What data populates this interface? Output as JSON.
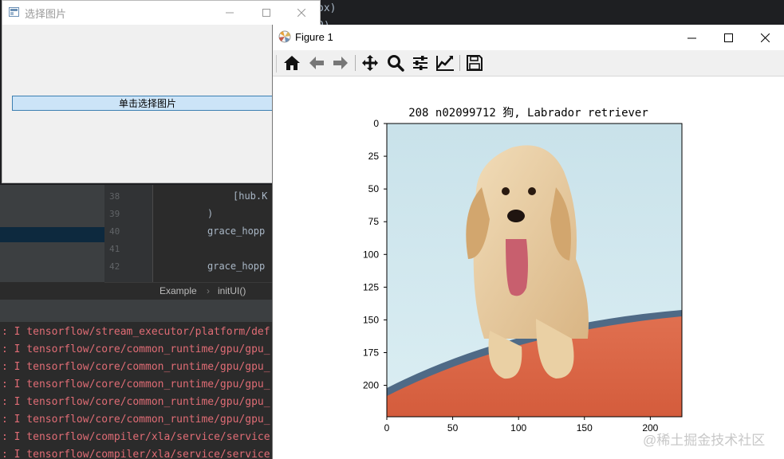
{
  "ide": {
    "top_snippet": [
      "ox)",
      "0)"
    ],
    "gutter": [
      "38",
      "39",
      "40",
      "41",
      "42"
    ],
    "code_lines": [
      "[hub.K",
      ")",
      "grace_hopp",
      "",
      "grace_hopp"
    ],
    "breadcrumb": {
      "item1": "Example",
      "separator": "›",
      "item2": "initUI()"
    },
    "console_lines": [
      ": I tensorflow/stream_executor/platform/def",
      ": I tensorflow/core/common_runtime/gpu/gpu_",
      ": I tensorflow/core/common_runtime/gpu/gpu_",
      ": I tensorflow/core/common_runtime/gpu/gpu_",
      ": I tensorflow/core/common_runtime/gpu/gpu_",
      ": I tensorflow/core/common_runtime/gpu/gpu_",
      ": I tensorflow/compiler/xla/service/service",
      ": I tensorflow/compiler/xla/service/service"
    ]
  },
  "chooser": {
    "title": "选择图片",
    "button_label": "单击选择图片",
    "app_icon": "window-app-icon",
    "controls": [
      "minimize-icon",
      "maximize-icon",
      "close-icon"
    ]
  },
  "figure": {
    "title": "Figure 1",
    "app_icon": "matplotlib-icon",
    "controls": [
      "minimize-icon",
      "maximize-icon",
      "close-icon"
    ],
    "toolbar": [
      "home-icon",
      "back-arrow-icon",
      "forward-arrow-icon",
      "pan-icon",
      "zoom-icon",
      "configure-subplots-icon",
      "edit-axis-icon",
      "save-icon"
    ],
    "plot_title": "208 n02099712 狗, Labrador retriever",
    "image_description_colors": {
      "sky": "#cfe6ee",
      "dog": "#e2c597",
      "boat": "#de6a4a"
    },
    "x_ticks": [
      "0",
      "50",
      "100",
      "150",
      "200"
    ],
    "y_ticks": [
      "0",
      "25",
      "50",
      "75",
      "100",
      "125",
      "150",
      "175",
      "200"
    ],
    "axis_range": {
      "x": [
        0,
        224
      ],
      "y": [
        0,
        224
      ]
    }
  },
  "watermark": "@稀土掘金技术社区"
}
